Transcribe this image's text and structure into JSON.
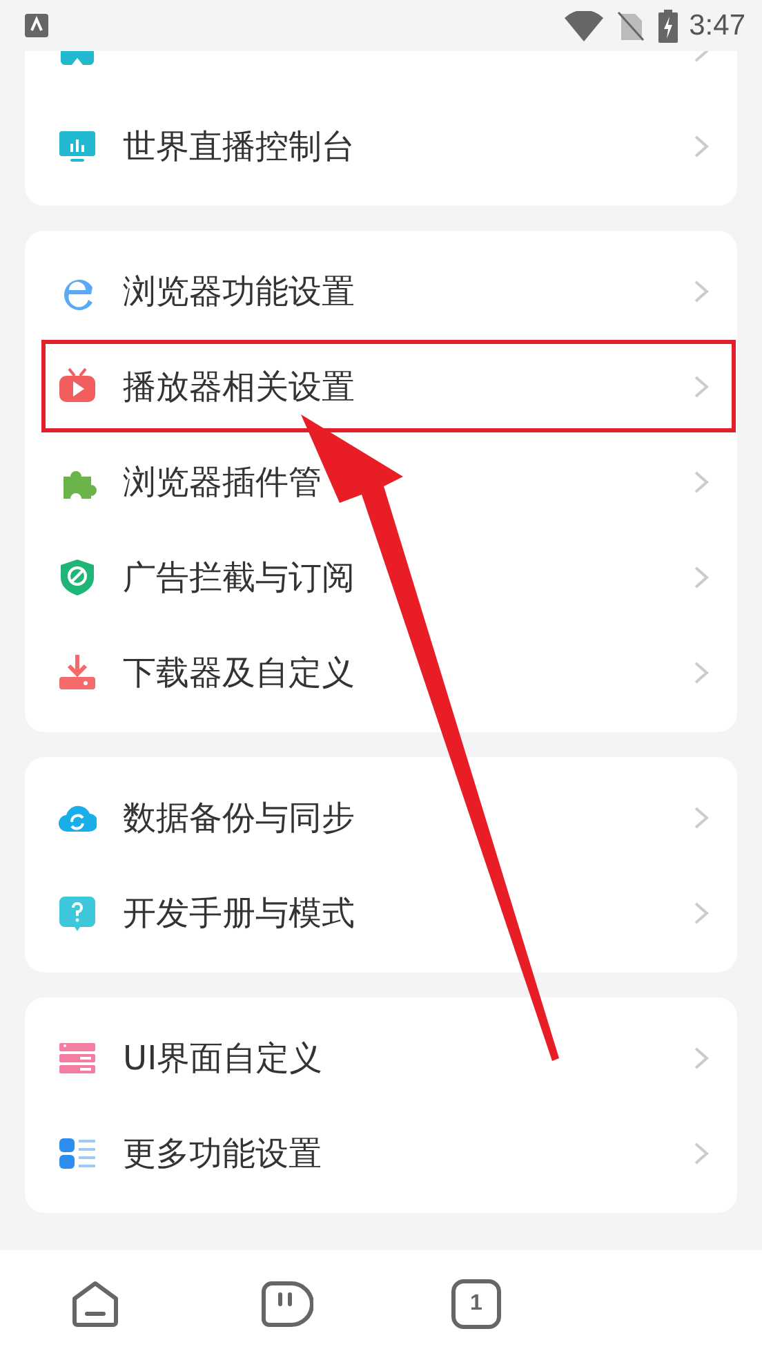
{
  "status_bar": {
    "time": "3:47"
  },
  "groups": [
    {
      "items": [
        {
          "kind": "bookmark",
          "highlighted": false
        },
        {
          "label": "世界直播控制台",
          "kind": "monitor",
          "highlighted": false
        }
      ]
    },
    {
      "items": [
        {
          "label": "浏览器功能设置",
          "kind": "browser",
          "highlighted": false
        },
        {
          "label": "播放器相关设置",
          "kind": "tv",
          "highlighted": true
        },
        {
          "label": "浏览器插件管",
          "kind": "puzzle",
          "highlighted": false
        },
        {
          "label": "广告拦截与订阅",
          "kind": "shield",
          "highlighted": false
        },
        {
          "label": "下载器及自定义",
          "kind": "download",
          "highlighted": false
        }
      ]
    },
    {
      "items": [
        {
          "label": "数据备份与同步",
          "kind": "cloud",
          "highlighted": false
        },
        {
          "label": "开发手册与模式",
          "kind": "help",
          "highlighted": false
        }
      ]
    },
    {
      "items": [
        {
          "label": "UI界面自定义",
          "kind": "layout",
          "highlighted": false
        },
        {
          "label": "更多功能设置",
          "kind": "list",
          "highlighted": false
        }
      ]
    }
  ],
  "bottom_nav": [
    {
      "kind": "home"
    },
    {
      "kind": "face"
    },
    {
      "kind": "tabs",
      "count": "1"
    }
  ]
}
